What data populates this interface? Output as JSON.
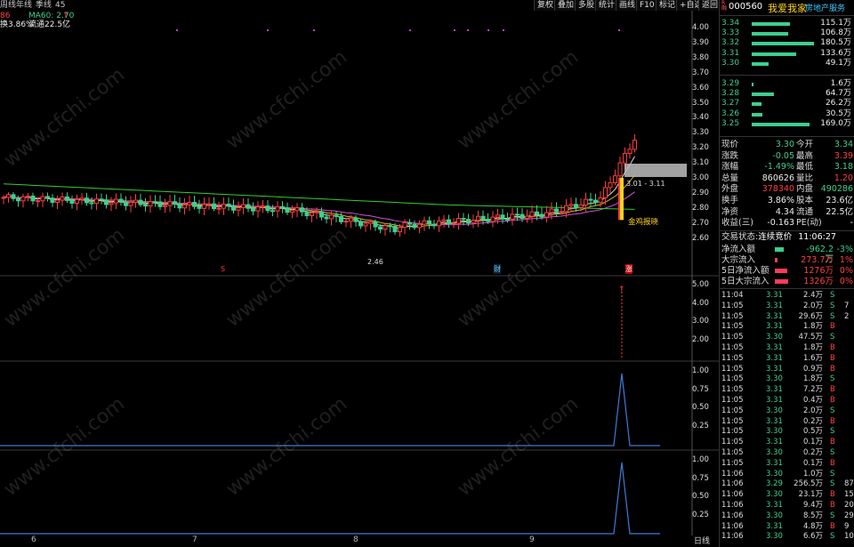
{
  "topbar": {
    "period_labels": [
      "周线",
      "年线",
      "季线",
      "45"
    ],
    "tools": [
      "复权",
      "叠加",
      "多股",
      "统计",
      "画线",
      "F10",
      "标记",
      "+自选",
      "返回"
    ]
  },
  "indicators": {
    "line1_prefix": "86",
    "ma60": "MA60: 2.70",
    "line2_prefix": "换3.86%",
    "line2_float": "流通22.5亿"
  },
  "price_axis": [
    "4.00",
    "3.90",
    "3.80",
    "3.70",
    "3.60",
    "3.50",
    "3.40",
    "3.30",
    "3.20",
    "3.10",
    "3.00",
    "2.90",
    "2.80",
    "2.70",
    "2.60"
  ],
  "vol_axis": [
    "5.00",
    "4.00",
    "3.00",
    "2.00"
  ],
  "ind1_axis": [
    "1.00",
    "0.75",
    "0.50",
    "0.25"
  ],
  "ind2_axis": [
    "1.00",
    "0.75",
    "0.50",
    "0.25"
  ],
  "x_labels": [
    "6",
    "7",
    "8",
    "9"
  ],
  "annotations": {
    "range": "3.01 - 3.11",
    "signal": "金鸡报晓",
    "low": "2.46",
    "marker_s": "S",
    "marker_cai": "财",
    "marker_zhang": "涨",
    "bottom_mode": "日线"
  },
  "stock": {
    "code": "000560",
    "name": "我爱我家",
    "industry": "房地产服务",
    "r_badge": "R\n融"
  },
  "orderbook_sell": [
    {
      "price": "3.34",
      "vol": "115.1万",
      "bar": 0.62
    },
    {
      "price": "3.33",
      "vol": "106.8万",
      "bar": 0.58
    },
    {
      "price": "3.32",
      "vol": "180.5万",
      "bar": 1.0
    },
    {
      "price": "3.31",
      "vol": "133.6万",
      "bar": 0.72
    },
    {
      "price": "3.30",
      "vol": "49.1万",
      "bar": 0.27
    }
  ],
  "orderbook_buy": [
    {
      "price": "3.29",
      "vol": "1.6万",
      "bar": 0.03
    },
    {
      "price": "3.28",
      "vol": "64.7万",
      "bar": 0.36
    },
    {
      "price": "3.27",
      "vol": "26.2万",
      "bar": 0.15
    },
    {
      "price": "3.26",
      "vol": "30.5万",
      "bar": 0.17
    },
    {
      "price": "3.25",
      "vol": "169.0万",
      "bar": 0.93
    }
  ],
  "quote": [
    {
      "l": "现价",
      "v": "3.30",
      "vc": "green",
      "l2": "今开",
      "v2": "3.34",
      "v2c": "green"
    },
    {
      "l": "涨跌",
      "v": "-0.05",
      "vc": "green",
      "l2": "最高",
      "v2": "3.39",
      "v2c": "red"
    },
    {
      "l": "涨幅",
      "v": "-1.49%",
      "vc": "green",
      "l2": "最低",
      "v2": "3.18",
      "v2c": "green"
    },
    {
      "l": "总量",
      "v": "860626",
      "vc": "white",
      "l2": "量比",
      "v2": "1.20",
      "v2c": "red"
    },
    {
      "l": "外盘",
      "v": "378340",
      "vc": "red",
      "l2": "内盘",
      "v2": "490286",
      "v2c": "green"
    },
    {
      "l": "换手",
      "v": "3.86%",
      "vc": "white",
      "l2": "股本",
      "v2": "23.6亿",
      "v2c": "white"
    },
    {
      "l": "净资",
      "v": "4.34",
      "vc": "white",
      "l2": "流通",
      "v2": "22.5亿",
      "v2c": "white"
    },
    {
      "l": "收益(三)",
      "v": "-0.163",
      "vc": "white",
      "l2": "PE(动)",
      "v2": "-",
      "v2c": "white"
    }
  ],
  "trade_status": {
    "label": "交易状态:",
    "value": "连续竞价",
    "time": "11:06:27"
  },
  "flows": [
    {
      "l": "净流入额",
      "v": "-962.2万",
      "pct": "-3%",
      "color": "green",
      "bar": 0.25
    },
    {
      "l": "大宗流入",
      "v": "273.7万",
      "pct": "1%",
      "color": "red",
      "bar": 0.08
    },
    {
      "l": "5日净流入额",
      "v": "1276万",
      "pct": "0%",
      "color": "red",
      "bar": 0.35
    },
    {
      "l": "5日大宗流入",
      "v": "1326万",
      "pct": "0%",
      "color": "red",
      "bar": 0.37
    }
  ],
  "ticks": [
    {
      "t": "11:04",
      "p": "3.31",
      "v": "2.4万",
      "d": "S",
      "n": ""
    },
    {
      "t": "11:05",
      "p": "3.31",
      "v": "2.0万",
      "d": "S",
      "n": "7"
    },
    {
      "t": "11:05",
      "p": "3.31",
      "v": "29.6万",
      "d": "S",
      "n": "2"
    },
    {
      "t": "11:05",
      "p": "3.31",
      "v": "1.8万",
      "d": "B",
      "n": ""
    },
    {
      "t": "11:05",
      "p": "3.30",
      "v": "47.5万",
      "d": "S",
      "n": ""
    },
    {
      "t": "11:05",
      "p": "3.31",
      "v": "1.8万",
      "d": "B",
      "n": ""
    },
    {
      "t": "11:05",
      "p": "3.31",
      "v": "1.6万",
      "d": "B",
      "n": ""
    },
    {
      "t": "11:05",
      "p": "3.31",
      "v": "0.9万",
      "d": "B",
      "n": ""
    },
    {
      "t": "11:05",
      "p": "3.30",
      "v": "1.8万",
      "d": "S",
      "n": ""
    },
    {
      "t": "11:05",
      "p": "3.31",
      "v": "7.2万",
      "d": "B",
      "n": ""
    },
    {
      "t": "11:05",
      "p": "3.31",
      "v": "0.4万",
      "d": "B",
      "n": ""
    },
    {
      "t": "11:05",
      "p": "3.30",
      "v": "2.0万",
      "d": "S",
      "n": ""
    },
    {
      "t": "11:05",
      "p": "3.31",
      "v": "0.2万",
      "d": "B",
      "n": ""
    },
    {
      "t": "11:05",
      "p": "3.30",
      "v": "0.5万",
      "d": "S",
      "n": ""
    },
    {
      "t": "11:05",
      "p": "3.31",
      "v": "0.1万",
      "d": "B",
      "n": ""
    },
    {
      "t": "11:05",
      "p": "3.30",
      "v": "0.2万",
      "d": "S",
      "n": ""
    },
    {
      "t": "11:05",
      "p": "3.31",
      "v": "0.1万",
      "d": "B",
      "n": ""
    },
    {
      "t": "11:06",
      "p": "3.30",
      "v": "1.0万",
      "d": "S",
      "n": ""
    },
    {
      "t": "11:06",
      "p": "3.29",
      "v": "256.5万",
      "d": "S",
      "n": "87"
    },
    {
      "t": "11:06",
      "p": "3.30",
      "v": "23.1万",
      "d": "B",
      "n": "15"
    },
    {
      "t": "11:06",
      "p": "3.31",
      "v": "9.4万",
      "d": "B",
      "n": "20"
    },
    {
      "t": "11:06",
      "p": "3.30",
      "v": "8.5万",
      "d": "S",
      "n": "29"
    },
    {
      "t": "11:06",
      "p": "3.31",
      "v": "4.8万",
      "d": "B",
      "n": "9"
    },
    {
      "t": "11:06",
      "p": "3.30",
      "v": "6.6万",
      "d": "S",
      "n": "10"
    }
  ],
  "colors": {
    "up": "#ff3b3b",
    "down": "#3ecf8e",
    "ma5": "#ffffff",
    "ma10": "#ffd21f",
    "ma20": "#ff5cff",
    "ma60": "#32cd32"
  },
  "watermark": "www.cfchi.com"
}
